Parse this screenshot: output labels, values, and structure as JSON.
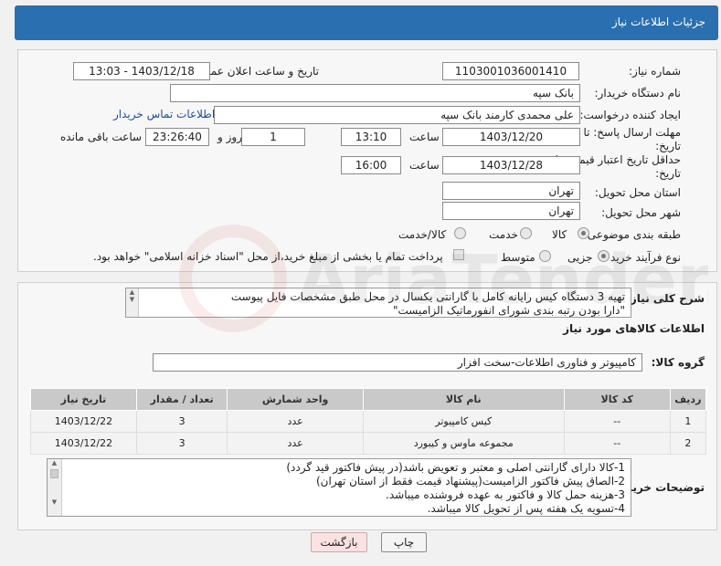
{
  "header": {
    "title": "جزئیات اطلاعات نیاز"
  },
  "form": {
    "need_number": {
      "label": "شماره نیاز:",
      "value": "1103001036001410"
    },
    "announce": {
      "label": "تاریخ و ساعت اعلان عمومی:",
      "value": "1403/12/18 - 13:03"
    },
    "buyer_org": {
      "label": "نام دستگاه خریدار:",
      "value": "بانک سپه"
    },
    "creator": {
      "label": "ایجاد کننده درخواست:",
      "value": "علی محمدی کارمند بانک سپه",
      "contact_link": "اطلاعات تماس خریدار"
    },
    "deadline": {
      "label": "مهلت ارسال پاسخ: تا تاریخ:",
      "date": "1403/12/20",
      "time_label": "ساعت",
      "time": "13:10",
      "days": "1",
      "days_label": "روز و",
      "remaining": "23:26:40",
      "remaining_label": "ساعت باقی مانده"
    },
    "validity": {
      "label": "حداقل تاریخ اعتبار قیمت: تا تاریخ:",
      "date": "1403/12/28",
      "time_label": "ساعت",
      "time": "16:00"
    },
    "province": {
      "label": "استان محل تحویل:",
      "value": "تهران"
    },
    "city": {
      "label": "شهر محل تحویل:",
      "value": "تهران"
    },
    "category": {
      "label": "طبقه بندی موضوعی:",
      "options": [
        "کالا",
        "خدمت",
        "کالا/خدمت"
      ],
      "selected": "کالا"
    },
    "process": {
      "label": "نوع فرآیند خرید :",
      "options": [
        "جزیی",
        "متوسط"
      ],
      "selected": "جزیی",
      "payment_note": "پرداخت تمام یا بخشی از مبلغ خرید،از محل \"اسناد خزانه اسلامی\" خواهد بود."
    }
  },
  "description": {
    "label": "شرح کلی نیاز:",
    "line1": "تهیه 3 دستگاه کیس رایانه کامل با گارانتی یکسال در محل طبق مشخصات فایل پیوست",
    "line2": "\"دارا بودن رتبه بندی شورای انفورماتیک الزامیست\""
  },
  "goods": {
    "section_title": "اطلاعات کالاهای مورد نیاز",
    "group_label": "گروه کالا:",
    "group_value": "کامپیوتر و فناوری اطلاعات-سخت افزار",
    "columns": [
      "ردیف",
      "کد کالا",
      "نام کالا",
      "واحد شمارش",
      "تعداد / مقدار",
      "تاریخ نیاز"
    ],
    "rows": [
      {
        "row": "1",
        "code": "--",
        "name": "کیس کامپیوتر",
        "unit": "عدد",
        "qty": "3",
        "date": "1403/12/22"
      },
      {
        "row": "2",
        "code": "--",
        "name": "مجموعه ماوس و کیبورد",
        "unit": "عدد",
        "qty": "3",
        "date": "1403/12/22"
      }
    ]
  },
  "buyer_notes": {
    "label": "توضیحات خریدار:",
    "lines": [
      "1-کالا دارای گارانتی اصلی و  معتبر و تعویض باشد(در پیش فاکتور قید گردد)",
      "2-الصاق پیش فاکتور الزامیست(پیشنهاد قیمت فقط از استان تهران)",
      "3-هزینه حمل کالا و فاکتور به عهده فروشنده میباشد.",
      "4-تسویه یک هفته پس از تحویل کالا میباشد."
    ]
  },
  "buttons": {
    "print": "چاپ",
    "back": "بازگشت"
  },
  "watermark": {
    "text": "AriaTender.neT"
  },
  "colors": {
    "header": "#2a6fb0",
    "link": "#1a4fa0",
    "back_button": "#fbe2e2"
  }
}
